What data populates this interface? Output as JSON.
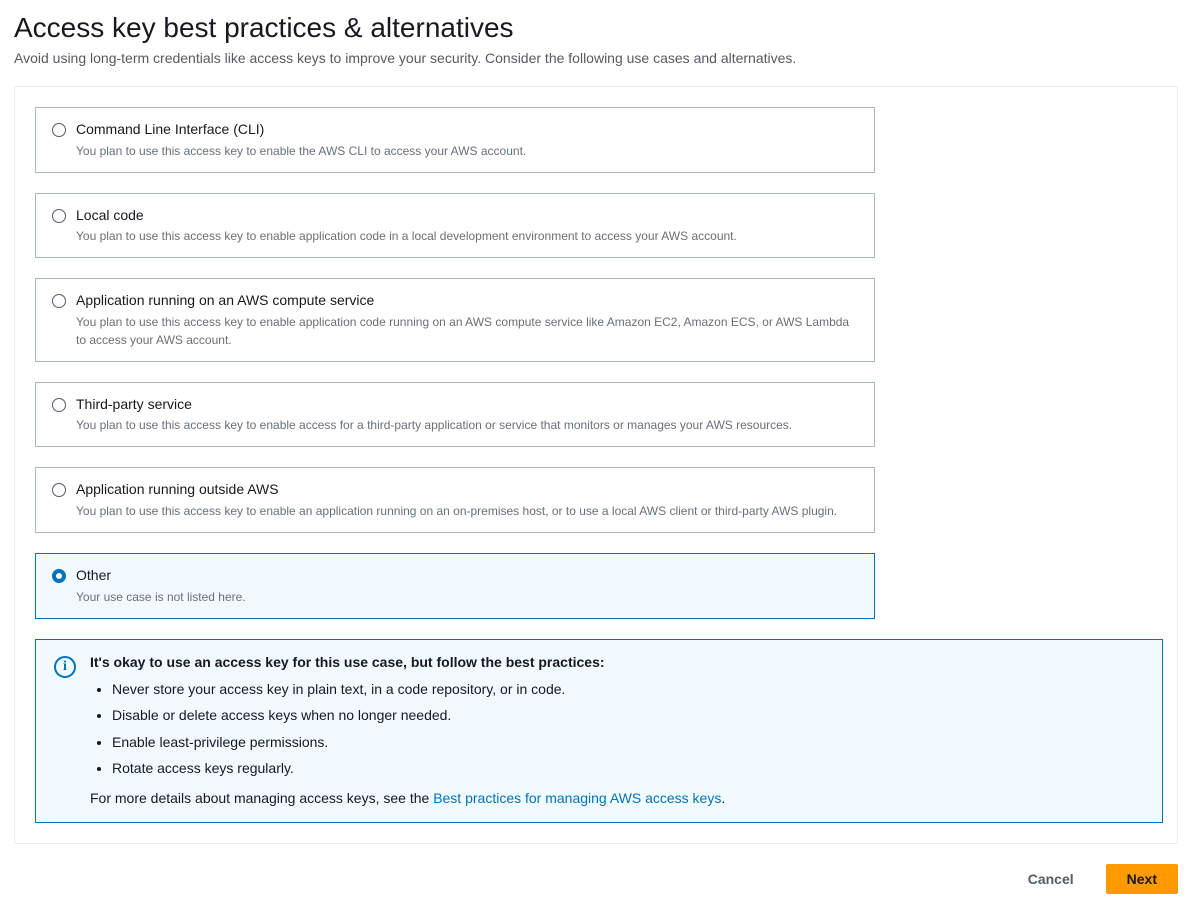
{
  "header": {
    "title": "Access key best practices & alternatives",
    "subtitle": "Avoid using long-term credentials like access keys to improve your security. Consider the following use cases and alternatives."
  },
  "options": [
    {
      "title": "Command Line Interface (CLI)",
      "desc": "You plan to use this access key to enable the AWS CLI to access your AWS account.",
      "selected": false
    },
    {
      "title": "Local code",
      "desc": "You plan to use this access key to enable application code in a local development environment to access your AWS account.",
      "selected": false
    },
    {
      "title": "Application running on an AWS compute service",
      "desc": "You plan to use this access key to enable application code running on an AWS compute service like Amazon EC2, Amazon ECS, or AWS Lambda to access your AWS account.",
      "selected": false
    },
    {
      "title": "Third-party service",
      "desc": "You plan to use this access key to enable access for a third-party application or service that monitors or manages your AWS resources.",
      "selected": false
    },
    {
      "title": "Application running outside AWS",
      "desc": "You plan to use this access key to enable an application running on an on-premises host, or to use a local AWS client or third-party AWS plugin.",
      "selected": false
    },
    {
      "title": "Other",
      "desc": "Your use case is not listed here.",
      "selected": true
    }
  ],
  "infoBox": {
    "title": "It's okay to use an access key for this use case, but follow the best practices:",
    "bullets": [
      "Never store your access key in plain text, in a code repository, or in code.",
      "Disable or delete access keys when no longer needed.",
      "Enable least-privilege permissions.",
      "Rotate access keys regularly."
    ],
    "footerPrefix": "For more details about managing access keys, see the ",
    "footerLink": "Best practices for managing AWS access keys",
    "footerSuffix": "."
  },
  "buttons": {
    "cancel": "Cancel",
    "next": "Next"
  }
}
